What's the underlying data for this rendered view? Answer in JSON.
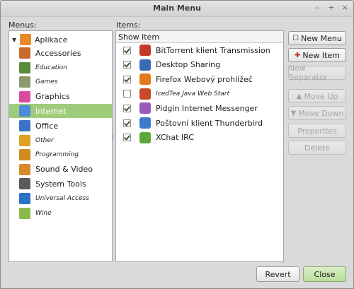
{
  "window": {
    "title": "Main Menu"
  },
  "labels": {
    "menus": "Menus:",
    "items": "Items:"
  },
  "menus": {
    "root": "Aplikace",
    "items": [
      {
        "label": "Accessories",
        "italic": false,
        "color": "#c96a2a"
      },
      {
        "label": "Education",
        "italic": true,
        "color": "#5a8a3a"
      },
      {
        "label": "Games",
        "italic": true,
        "color": "#8a9a6a"
      },
      {
        "label": "Graphics",
        "italic": false,
        "color": "#d84aa0"
      },
      {
        "label": "Internet",
        "italic": false,
        "color": "#4a8ad8",
        "selected": true
      },
      {
        "label": "Office",
        "italic": false,
        "color": "#3a72c8"
      },
      {
        "label": "Other",
        "italic": true,
        "color": "#e0a020"
      },
      {
        "label": "Programming",
        "italic": true,
        "color": "#d08a20"
      },
      {
        "label": "Sound & Video",
        "italic": false,
        "color": "#d88a2a"
      },
      {
        "label": "System Tools",
        "italic": false,
        "color": "#5a5a5a"
      },
      {
        "label": "Universal Access",
        "italic": true,
        "color": "#2a72c8"
      },
      {
        "label": "Wine",
        "italic": true,
        "color": "#8ab84a"
      }
    ]
  },
  "items_table": {
    "headers": {
      "show": "Show",
      "item": "Item"
    },
    "rows": [
      {
        "label": "BitTorrent klient Transmission",
        "checked": true,
        "italic": false,
        "color": "#c23a2a"
      },
      {
        "label": "Desktop Sharing",
        "checked": true,
        "italic": false,
        "color": "#3a6ab8"
      },
      {
        "label": "Firefox Webový prohlížeč",
        "checked": true,
        "italic": false,
        "color": "#e07a1a"
      },
      {
        "label": "IcedTea Java Web Start",
        "checked": false,
        "italic": true,
        "color": "#c84a2a"
      },
      {
        "label": "Pidgin Internet Messenger",
        "checked": true,
        "italic": false,
        "color": "#9a5ab8"
      },
      {
        "label": "Poštovní klient Thunderbird",
        "checked": true,
        "italic": false,
        "color": "#3a7ac8"
      },
      {
        "label": "XChat IRC",
        "checked": true,
        "italic": false,
        "color": "#5aa83a"
      }
    ]
  },
  "actions": {
    "new_menu": "New Menu",
    "new_item": "New Item",
    "new_separator": "New Separator",
    "move_up": "Move Up",
    "move_down": "Move Down",
    "properties": "Properties",
    "delete": "Delete"
  },
  "footer": {
    "revert": "Revert",
    "close": "Close"
  }
}
